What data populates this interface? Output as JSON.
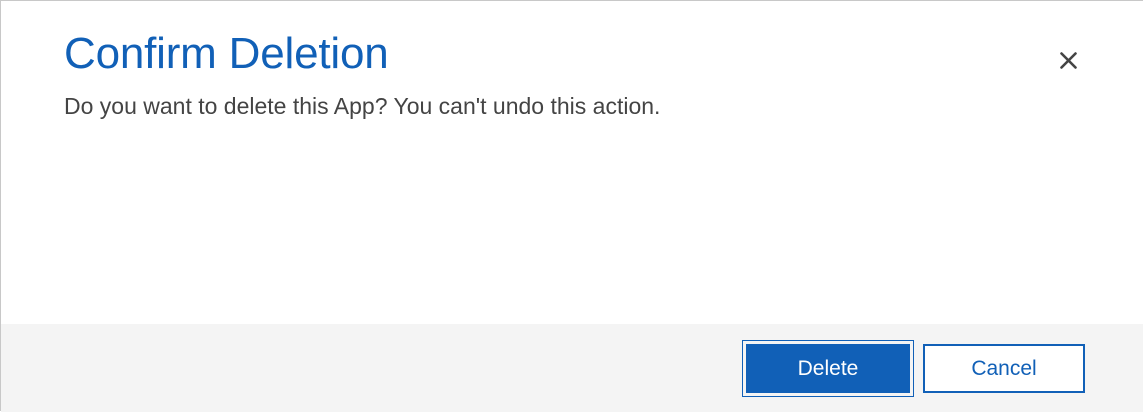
{
  "dialog": {
    "title": "Confirm Deletion",
    "message": "Do you want to delete this App? You can't undo this action.",
    "close_icon": "close-icon",
    "buttons": {
      "delete_label": "Delete",
      "cancel_label": "Cancel"
    },
    "colors": {
      "accent": "#1160b7",
      "text": "#444444",
      "footer_bg": "#f4f4f4"
    }
  }
}
